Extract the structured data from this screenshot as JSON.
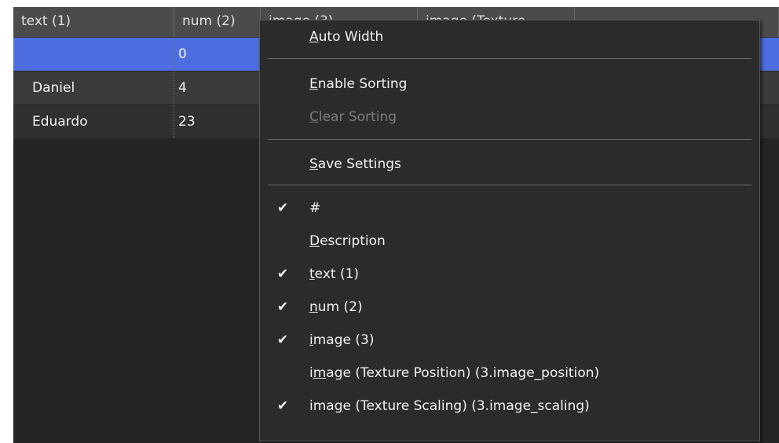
{
  "columns": [
    {
      "label": "text (1)",
      "width": 205
    },
    {
      "label": "num (2)",
      "width": 110
    },
    {
      "label": "image (3)",
      "width": 200
    },
    {
      "label": "image (Texture",
      "width": 200
    },
    {
      "label": "",
      "width": 260
    }
  ],
  "rows": [
    {
      "text": "",
      "num": "0",
      "state": "selected"
    },
    {
      "text": "Daniel",
      "num": "4",
      "state": "odd"
    },
    {
      "text": "Eduardo",
      "num": "23",
      "state": "even"
    }
  ],
  "menu": {
    "items": [
      {
        "type": "item",
        "pre": "",
        "ul": "A",
        "post": "uto Width",
        "checked": false,
        "disabled": false,
        "name": "menu-item-auto-width"
      },
      {
        "type": "sep"
      },
      {
        "type": "item",
        "pre": "",
        "ul": "E",
        "post": "nable Sorting",
        "checked": false,
        "disabled": false,
        "name": "menu-item-enable-sorting"
      },
      {
        "type": "item",
        "pre": "",
        "ul": "C",
        "post": "lear Sorting",
        "checked": false,
        "disabled": true,
        "name": "menu-item-clear-sorting"
      },
      {
        "type": "sep"
      },
      {
        "type": "item",
        "pre": "",
        "ul": "S",
        "post": "ave Settings",
        "checked": false,
        "disabled": false,
        "name": "menu-item-save-settings"
      },
      {
        "type": "sep"
      },
      {
        "type": "item",
        "pre": "#",
        "ul": "",
        "post": "",
        "checked": true,
        "disabled": false,
        "name": "menu-item-column-hash"
      },
      {
        "type": "item",
        "pre": "",
        "ul": "D",
        "post": "escription",
        "checked": false,
        "disabled": false,
        "name": "menu-item-column-description"
      },
      {
        "type": "item",
        "pre": "",
        "ul": "t",
        "post": "ext (1)",
        "checked": true,
        "disabled": false,
        "name": "menu-item-column-text"
      },
      {
        "type": "item",
        "pre": "",
        "ul": "n",
        "post": "um (2)",
        "checked": true,
        "disabled": false,
        "name": "menu-item-column-num"
      },
      {
        "type": "item",
        "pre": "",
        "ul": "i",
        "post": "mage (3)",
        "checked": true,
        "disabled": false,
        "name": "menu-item-column-image"
      },
      {
        "type": "item",
        "pre": "i",
        "ul": "m",
        "post": "age (Texture Position) (3.image_position)",
        "checked": false,
        "disabled": false,
        "name": "menu-item-column-image-position"
      },
      {
        "type": "item",
        "pre": "ima",
        "ul": "g",
        "post": "e (Texture Scaling) (3.image_scaling)",
        "checked": true,
        "disabled": false,
        "name": "menu-item-column-image-scaling"
      }
    ],
    "check_glyph": "✔"
  },
  "colors": {
    "selection": "#4e6de0",
    "background": "#252525",
    "header": "#4b4b4b",
    "menu_bg": "#2b2b2b",
    "text": "#f2f2f2",
    "disabled_text": "#7c7c7c"
  }
}
